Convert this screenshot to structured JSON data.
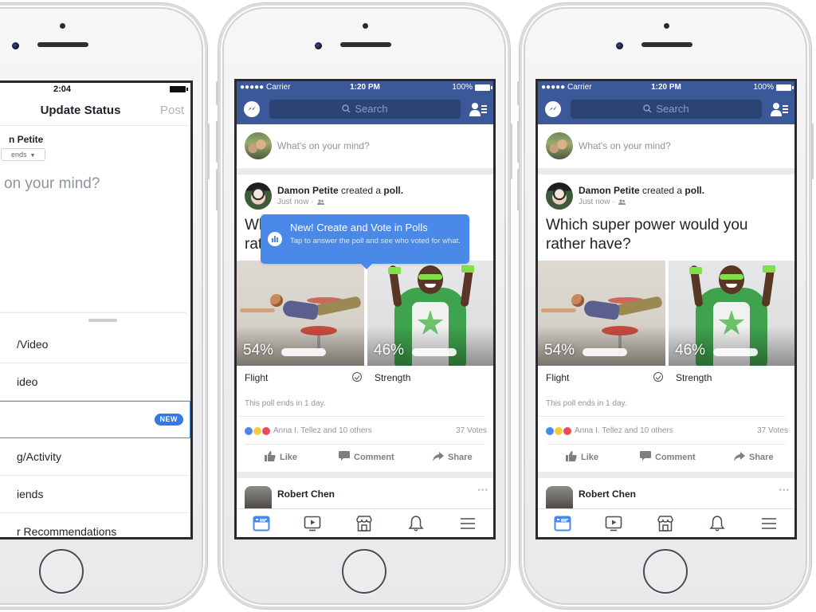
{
  "phone_left": {
    "status_time": "2:04",
    "nav_title": "Update Status",
    "post_button": "Post",
    "user_name": "n Petite",
    "audience": "ends",
    "prompt": "on your mind?",
    "options": [
      {
        "label": "/Video",
        "selected": false,
        "badge": ""
      },
      {
        "label": "ideo",
        "selected": false,
        "badge": ""
      },
      {
        "label": "",
        "selected": true,
        "badge": "NEW"
      },
      {
        "label": "g/Activity",
        "selected": false,
        "badge": ""
      },
      {
        "label": "iends",
        "selected": false,
        "badge": ""
      },
      {
        "label": "r Recommendations",
        "selected": false,
        "badge": ""
      }
    ]
  },
  "feed": {
    "status_bar": {
      "carrier": "●●●●● Carrier",
      "time": "1:20 PM",
      "battery": "100%"
    },
    "search_placeholder": "Search",
    "composer_prompt": "What's on your mind?",
    "post": {
      "author": "Damon Petite",
      "action": "created a",
      "object": "poll.",
      "time": "Just now",
      "question": "Which super power would you rather have?",
      "options": [
        {
          "label": "Flight",
          "percent": "54%",
          "percent_value": 54
        },
        {
          "label": "Strength",
          "percent": "46%",
          "percent_value": 46
        }
      ],
      "voted_option": "Flight",
      "poll_ends": "This poll ends in 1 day.",
      "reactions_text": "Anna I. Tellez and 10 others",
      "votes": "37 Votes",
      "actions": {
        "like": "Like",
        "comment": "Comment",
        "share": "Share"
      }
    },
    "next_post_author": "Robert Chen",
    "tabs": [
      "news-feed",
      "watch",
      "marketplace",
      "notifications",
      "menu"
    ],
    "active_tab": "news-feed"
  },
  "tooltip": {
    "title": "New! Create and Vote in Polls",
    "description": "Tap to answer the poll and see who voted for what."
  },
  "colors": {
    "brand": "#3b5998",
    "search_bg": "#2d4373",
    "tooltip": "#4a89e8",
    "badge": "#3578e5",
    "active_tab": "#4a88e8"
  }
}
